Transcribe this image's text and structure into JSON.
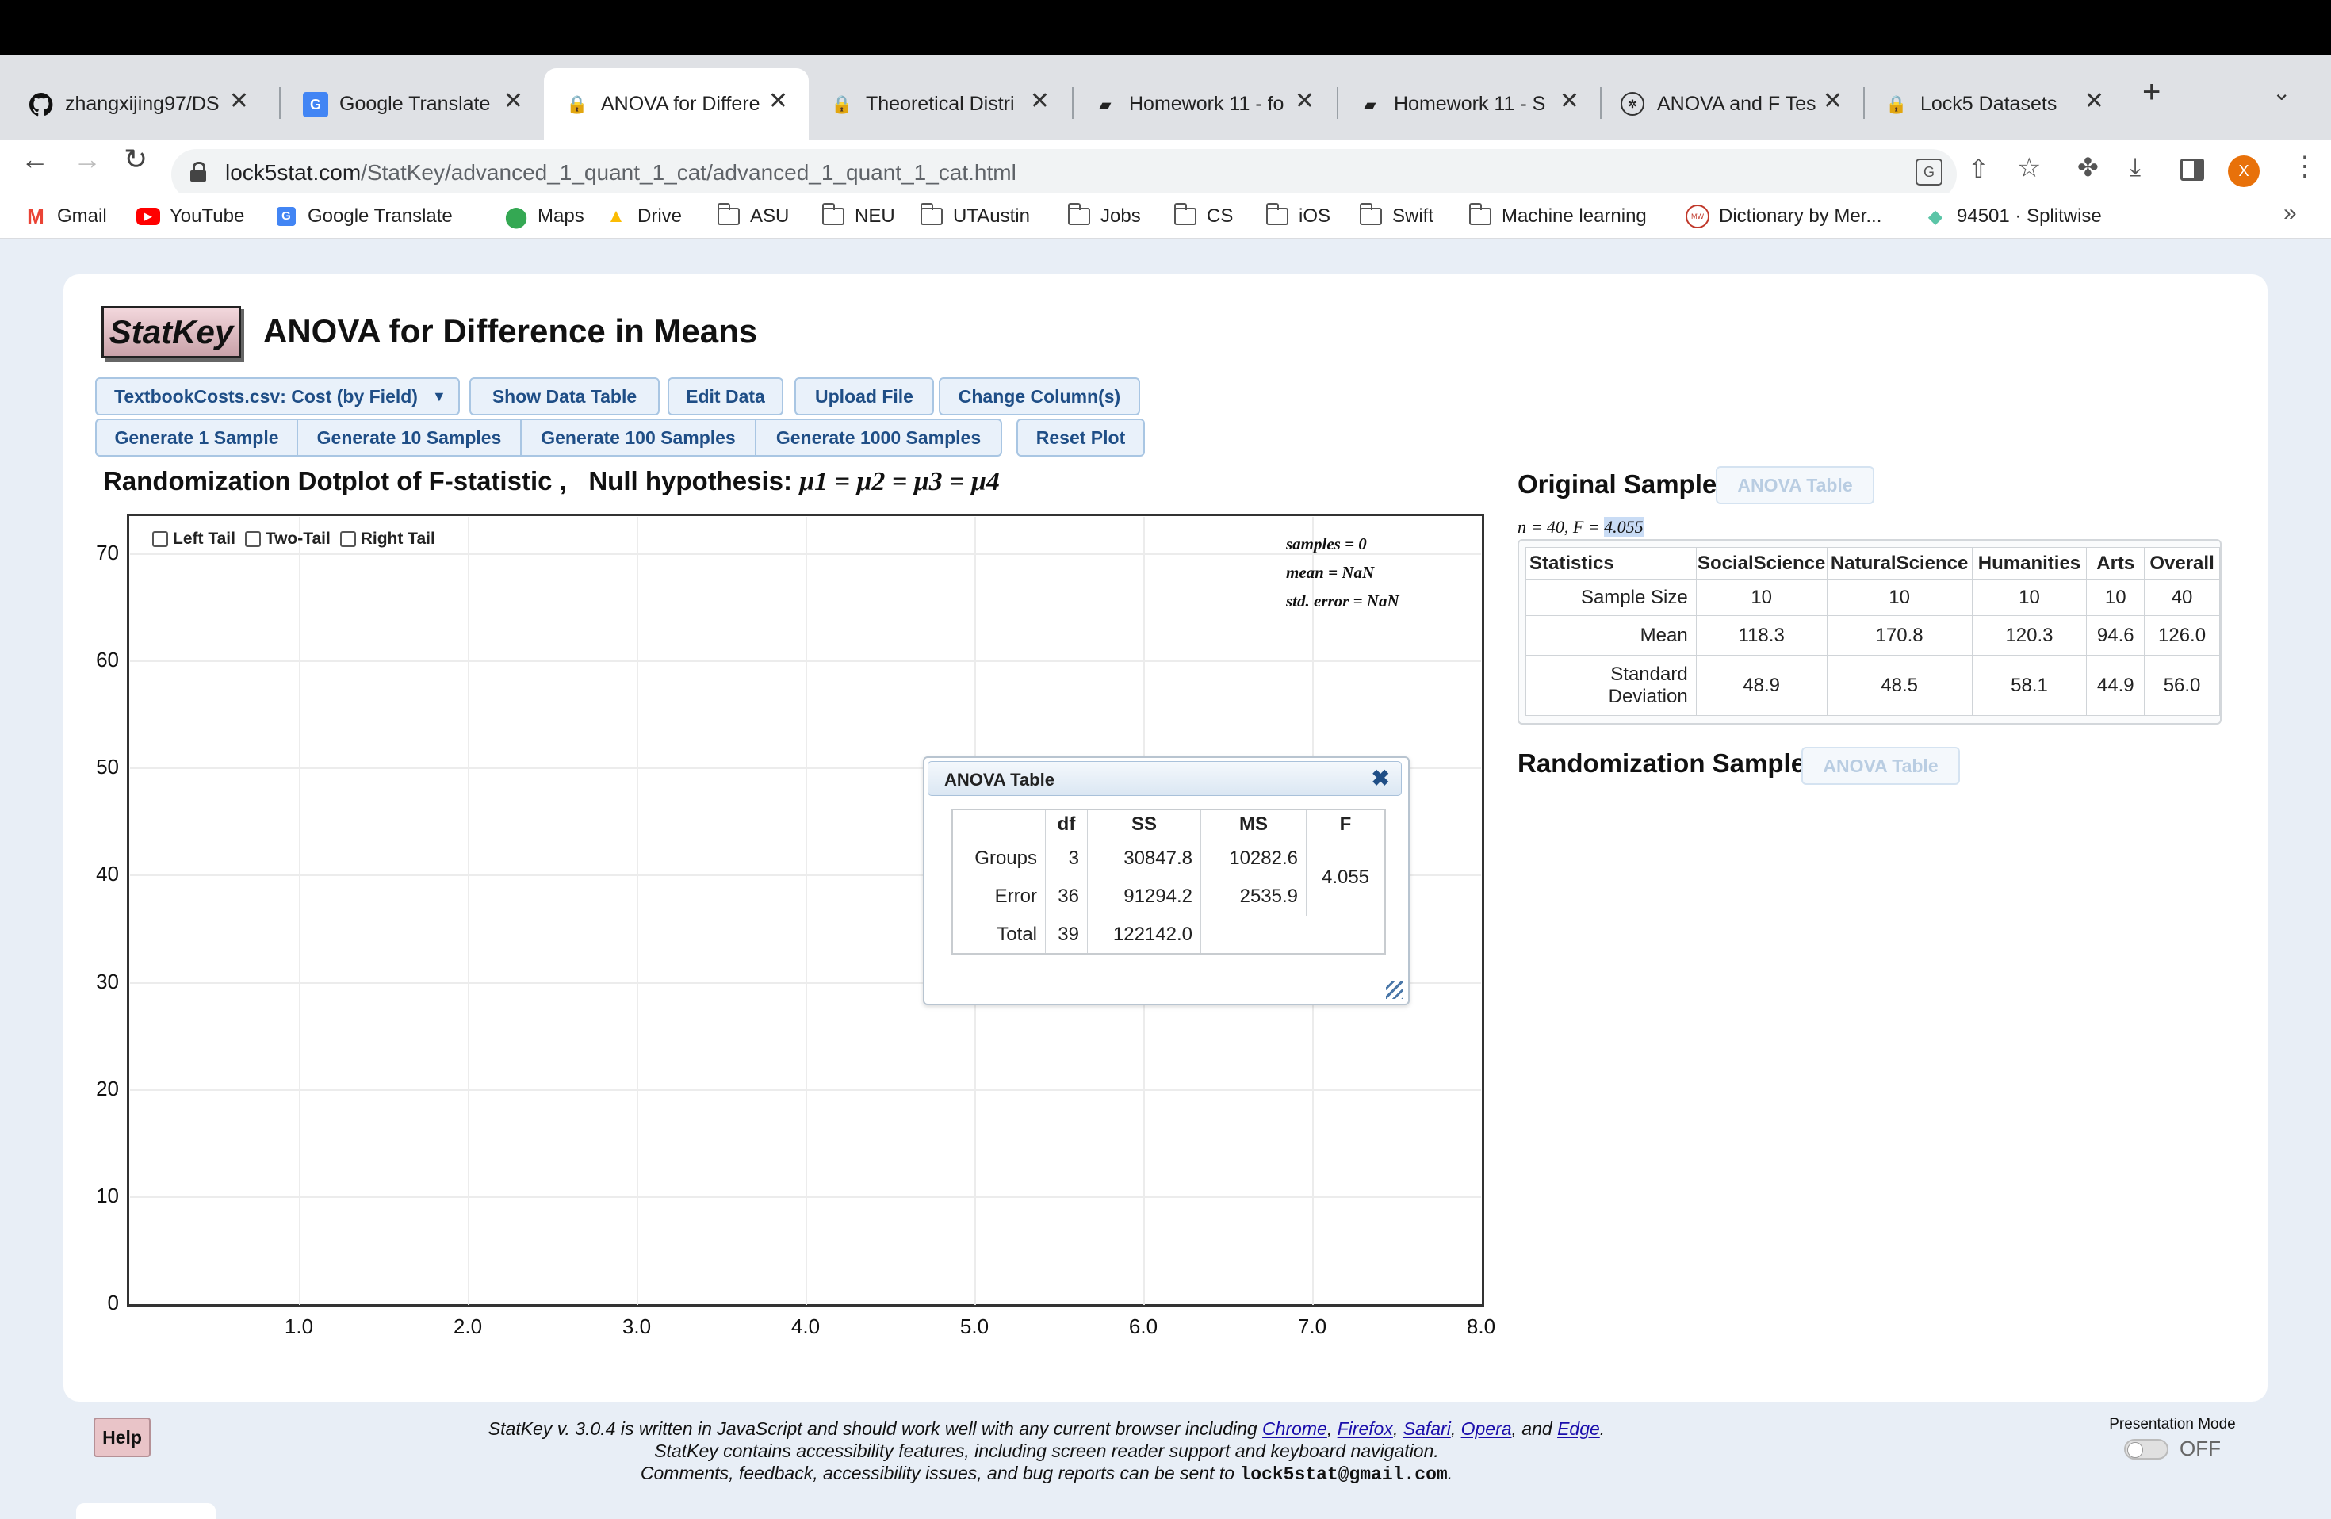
{
  "browser": {
    "tabs": [
      {
        "title": "zhangxijing97/DS",
        "icon": "github-icon"
      },
      {
        "title": "Google Translate",
        "icon": "google-translate-icon"
      },
      {
        "title": "ANOVA for Differe",
        "icon": "lock5-icon",
        "active": true
      },
      {
        "title": "Theoretical Distri",
        "icon": "lock5-icon"
      },
      {
        "title": "Homework 11 - fo",
        "icon": "homework-icon"
      },
      {
        "title": "Homework 11 - S",
        "icon": "homework-icon"
      },
      {
        "title": "ANOVA and F Tes",
        "icon": "chatgpt-icon"
      },
      {
        "title": "Lock5 Datasets",
        "icon": "lock5-icon"
      }
    ],
    "url_host": "lock5stat.com",
    "url_path": "/StatKey/advanced_1_quant_1_cat/advanced_1_quant_1_cat.html",
    "profile_initial": "X",
    "bookmarks": [
      {
        "label": "Gmail",
        "icon": "gmail-icon"
      },
      {
        "label": "YouTube",
        "icon": "youtube-icon"
      },
      {
        "label": "Google Translate",
        "icon": "google-translate-icon"
      },
      {
        "label": "Maps",
        "icon": "maps-icon"
      },
      {
        "label": "Drive",
        "icon": "drive-icon"
      },
      {
        "label": "ASU",
        "icon": "folder-icon"
      },
      {
        "label": "NEU",
        "icon": "folder-icon"
      },
      {
        "label": "UTAustin",
        "icon": "folder-icon"
      },
      {
        "label": "Jobs",
        "icon": "folder-icon"
      },
      {
        "label": "CS",
        "icon": "folder-icon"
      },
      {
        "label": "iOS",
        "icon": "folder-icon"
      },
      {
        "label": "Swift",
        "icon": "folder-icon"
      },
      {
        "label": "Machine learning",
        "icon": "folder-icon"
      },
      {
        "label": "Dictionary by Mer...",
        "icon": "merriam-webster-icon"
      },
      {
        "label": "94501 · Splitwise",
        "icon": "splitwise-icon"
      }
    ],
    "more_bookmarks": "»"
  },
  "statkey": {
    "logo": "StatKey",
    "title": "ANOVA for Difference in Means",
    "dataset_select": "TextbookCosts.csv: Cost (by Field)",
    "buttons_row1": [
      "Show Data Table",
      "Edit Data",
      "Upload File",
      "Change Column(s)"
    ],
    "buttons_row2": [
      "Generate 1 Sample",
      "Generate 10 Samples",
      "Generate 100 Samples",
      "Generate 1000 Samples"
    ],
    "reset_plot": "Reset Plot",
    "plot_title": "Randomization Dotplot of F-statistic ,",
    "null_label": "Null hypothesis:",
    "null_hypothesis": "μ1 = μ2 = μ3 = μ4",
    "tails": [
      "Left Tail",
      "Two-Tail",
      "Right Tail"
    ],
    "plot_stats": [
      "samples = 0",
      "mean = NaN",
      "std. error = NaN"
    ],
    "original_sample_heading": "Original Sample",
    "anova_table_button": "ANOVA Table",
    "n_f_prefix": "n = 40, F = ",
    "f_value": "4.055",
    "stats_table": {
      "headers": [
        "Statistics",
        "SocialScience",
        "NaturalScience",
        "Humanities",
        "Arts",
        "Overall"
      ],
      "rows": [
        [
          "Sample Size",
          "10",
          "10",
          "10",
          "10",
          "40"
        ],
        [
          "Mean",
          "118.3",
          "170.8",
          "120.3",
          "94.6",
          "126.0"
        ],
        [
          "Standard Deviation",
          "48.9",
          "48.5",
          "58.1",
          "44.9",
          "56.0"
        ]
      ]
    },
    "randomization_sample_heading": "Randomization Sample",
    "anova_dialog": {
      "title": "ANOVA Table",
      "headers": [
        "",
        "df",
        "SS",
        "MS",
        "F"
      ],
      "rows": [
        [
          "Groups",
          "3",
          "30847.8",
          "10282.6"
        ],
        [
          "Error",
          "36",
          "91294.2",
          "2535.9"
        ],
        [
          "Total",
          "39",
          "122142.0",
          ""
        ]
      ],
      "f": "4.055"
    },
    "help": "Help",
    "footer_line1_before": "StatKey v. 3.0.4 is written in JavaScript and should work well with any current browser including ",
    "footer_browsers": [
      "Chrome",
      "Firefox",
      "Safari",
      "Opera",
      "Edge"
    ],
    "footer_line2": "StatKey contains accessibility features, including screen reader support and keyboard navigation.",
    "footer_line3": "Comments, feedback, accessibility issues, and bug reports can be sent to ",
    "footer_email": "lock5stat@gmail.com",
    "presentation_mode_label": "Presentation Mode",
    "presentation_mode_state": "OFF"
  },
  "chart_data": {
    "type": "scatter",
    "title": "Randomization Dotplot of F-statistic",
    "x_ticks": [
      "1.0",
      "2.0",
      "3.0",
      "4.0",
      "5.0",
      "6.0",
      "7.0",
      "8.0"
    ],
    "y_ticks": [
      "0",
      "10",
      "20",
      "30",
      "40",
      "50",
      "60",
      "70"
    ],
    "xlim": [
      0,
      8
    ],
    "ylim": [
      0,
      70
    ],
    "points": [],
    "grid": true
  }
}
